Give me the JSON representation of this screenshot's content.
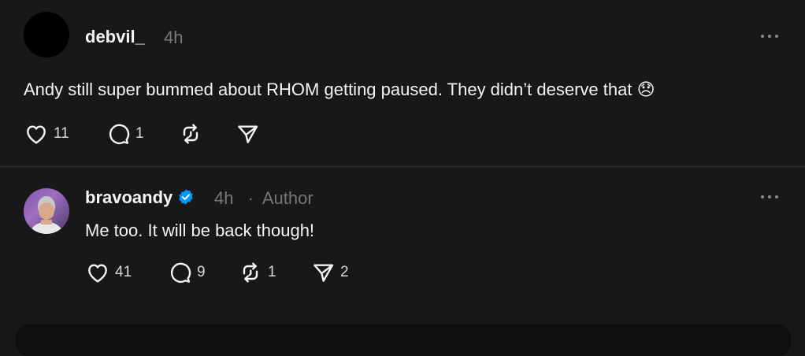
{
  "posts": [
    {
      "username": "debvil_",
      "time": "4h",
      "text": "Andy still super bummed about RHOM getting paused. They didn’t deserve that 😞",
      "likes": "11",
      "replies": "1",
      "reposts": "",
      "shares": ""
    },
    {
      "username": "bravoandy",
      "verified": true,
      "time": "4h",
      "separator": "·",
      "author_label": "Author",
      "text": "Me too. It will be back though!",
      "likes": "41",
      "replies": "9",
      "reposts": "1",
      "shares": "2"
    }
  ],
  "icons": {
    "like": "heart-icon",
    "reply": "comment-icon",
    "repost": "repost-icon",
    "share": "send-icon",
    "more": "more-horizontal-icon",
    "verified": "verified-badge-icon"
  },
  "colors": {
    "background": "#181818",
    "text": "#f3f5f7",
    "muted": "#777777",
    "verified": "#0095f6"
  }
}
